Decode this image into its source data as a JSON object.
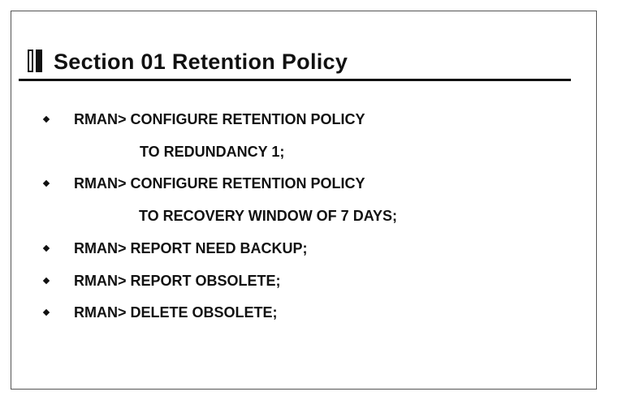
{
  "slide": {
    "title": "Section 01 Retention Policy",
    "bullets": [
      {
        "text": "RMAN> CONFIGURE RETENTION POLICY",
        "continuation": "TO REDUNDANCY 1;"
      },
      {
        "text": "RMAN> CONFIGURE RETENTION POLICY",
        "continuation": "TO RECOVERY WINDOW OF 7 DAYS;"
      },
      {
        "text": "RMAN> REPORT NEED BACKUP;"
      },
      {
        "text": "RMAN> REPORT OBSOLETE;"
      },
      {
        "text": "RMAN> DELETE OBSOLETE;"
      }
    ]
  },
  "colors": {
    "text": "#111111",
    "border": "#555555",
    "background": "#ffffff"
  }
}
